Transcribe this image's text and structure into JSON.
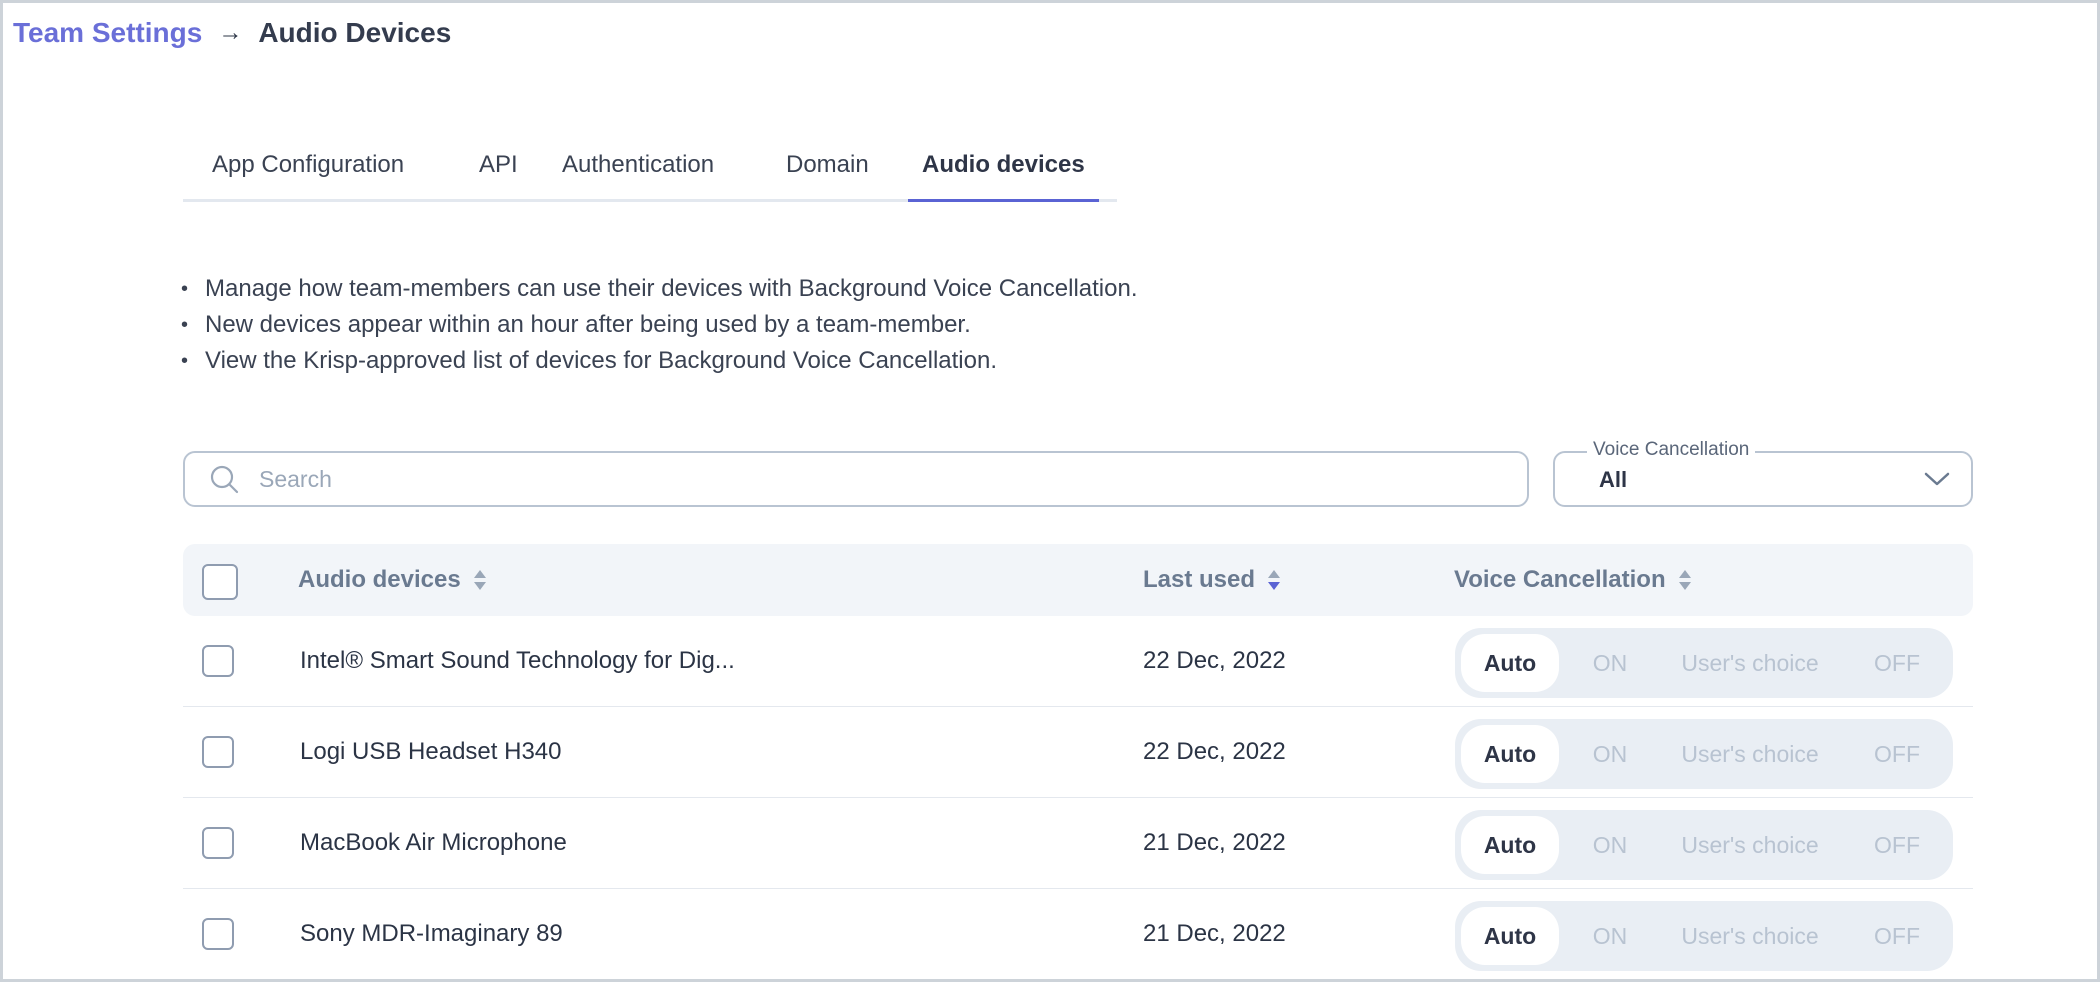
{
  "breadcrumb": {
    "parent": "Team Settings",
    "separator": "→",
    "current": "Audio Devices"
  },
  "tabs": [
    {
      "label": "App Configuration",
      "active": false
    },
    {
      "label": "API",
      "active": false
    },
    {
      "label": "Authentication",
      "active": false
    },
    {
      "label": "Domain",
      "active": false
    },
    {
      "label": "Audio devices",
      "active": true
    }
  ],
  "info": [
    "Manage how team-members can use their devices with Background Voice Cancellation.",
    "New devices appear within an hour after being used by a team-member.",
    "View the Krisp-approved list of devices for Background Voice Cancellation."
  ],
  "search": {
    "placeholder": "Search",
    "value": ""
  },
  "filter": {
    "label": "Voice Cancellation",
    "value": "All"
  },
  "table": {
    "headers": {
      "device": "Audio devices",
      "last_used": "Last used",
      "voice_cancellation": "Voice Cancellation"
    },
    "segment_options": [
      "Auto",
      "ON",
      "User's choice",
      "OFF"
    ],
    "rows": [
      {
        "device": "Intel® Smart Sound Technology for Dig...",
        "last_used": "22 Dec, 2022",
        "mode": "Auto"
      },
      {
        "device": "Logi USB Headset H340",
        "last_used": "22 Dec, 2022",
        "mode": "Auto"
      },
      {
        "device": "MacBook Air Microphone",
        "last_used": "21 Dec, 2022",
        "mode": "Auto"
      },
      {
        "device": "Sony MDR-Imaginary 89",
        "last_used": "21 Dec, 2022",
        "mode": "Auto"
      }
    ]
  },
  "colors": {
    "accent": "#5a63d4",
    "link": "#6a6fd8",
    "header_bg": "#f2f5f9",
    "segment_bg": "#e9eef4"
  }
}
